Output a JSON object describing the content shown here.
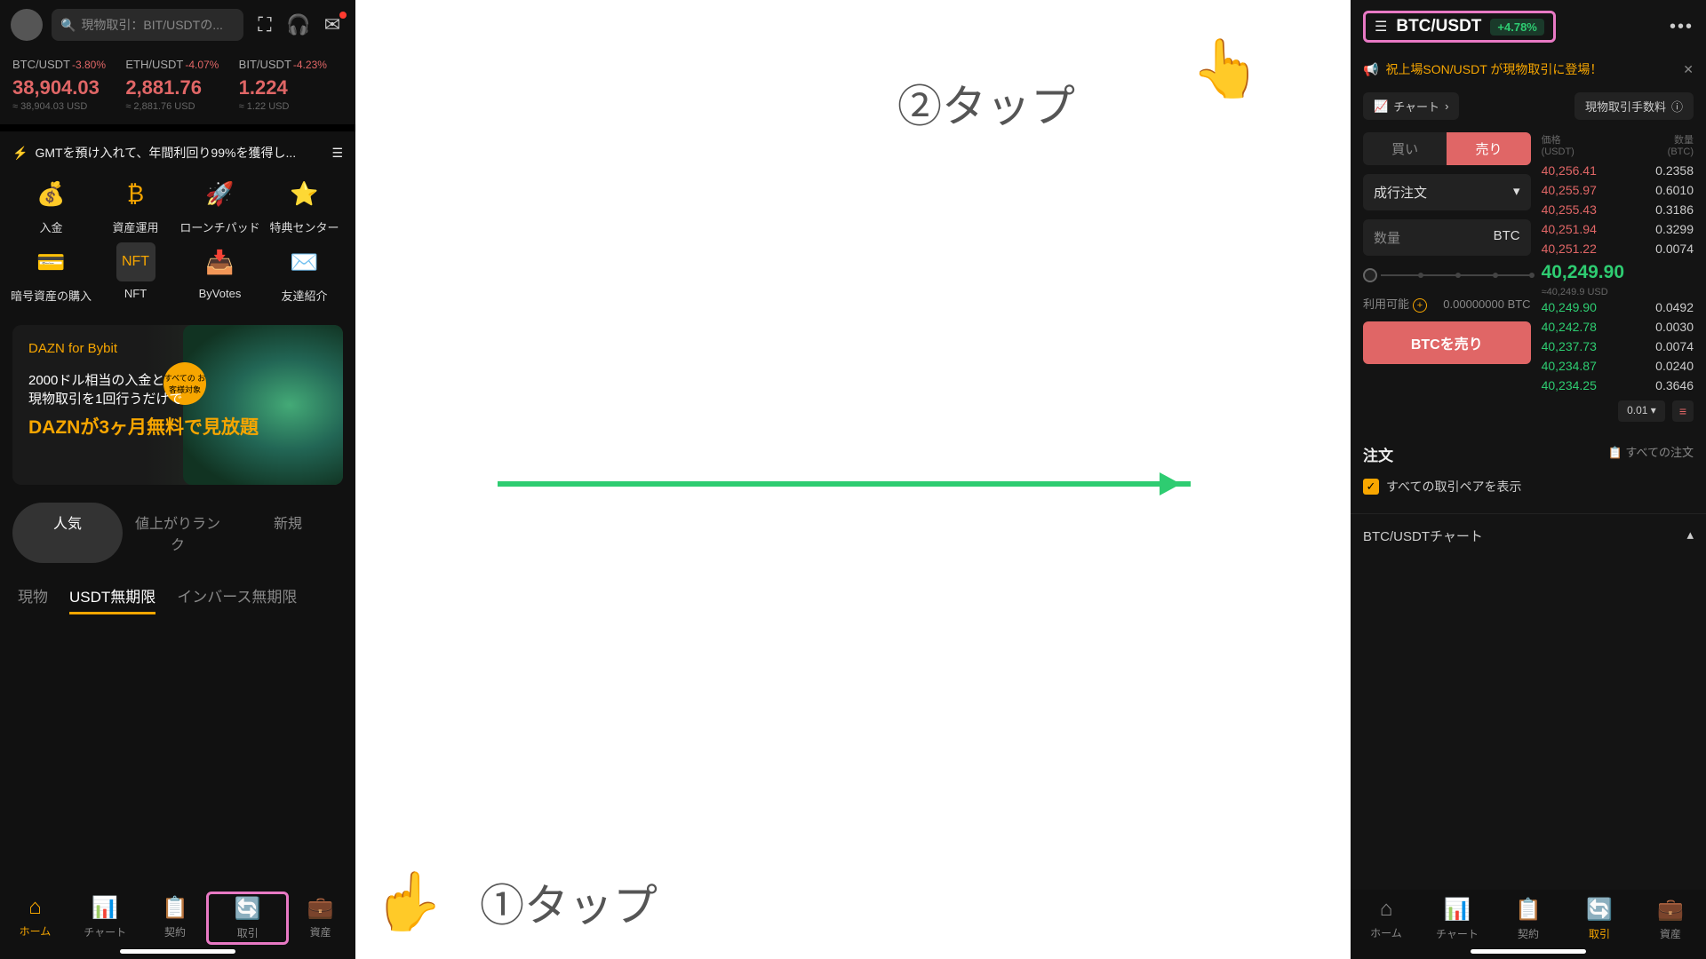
{
  "annotations": {
    "tap1": "①タップ",
    "tap2": "②タップ"
  },
  "left": {
    "search_placeholder": "現物取引：BIT/USDTの...",
    "tickers": [
      {
        "pair": "BTC/USDT",
        "chg": "-3.80%",
        "price": "38,904.03",
        "usd": "≈ 38,904.03 USD"
      },
      {
        "pair": "ETH/USDT",
        "chg": "-4.07%",
        "price": "2,881.76",
        "usd": "≈ 2,881.76 USD"
      },
      {
        "pair": "BIT/USDT",
        "chg": "-4.23%",
        "price": "1.224",
        "usd": "≈ 1.22 USD"
      }
    ],
    "banner": "GMTを預け入れて、年間利回り99%を獲得し...",
    "grid": [
      "入金",
      "資産運用",
      "ローンチパッド",
      "特典センター",
      "暗号資産の購入",
      "NFT",
      "ByVotes",
      "友達紹介"
    ],
    "promo": {
      "t1": "DAZN for Bybit",
      "t2": "2000ドル相当の入金と",
      "t3": "現物取引を1回行うだけで",
      "t4": "DAZNが3ヶ月無料で見放題",
      "badge": "すべての\nお客様対象"
    },
    "pills": [
      "人気",
      "値上がりランク",
      "新規"
    ],
    "tabs": [
      "現物",
      "USDT無期限",
      "インバース無期限"
    ],
    "nav": [
      "ホーム",
      "チャート",
      "契約",
      "取引",
      "資産"
    ]
  },
  "right": {
    "pair": "BTC/USDT",
    "change": "+4.78%",
    "announce": "祝上場SON/USDT が現物取引に登場！",
    "chart_label": "チャート",
    "fee_label": "現物取引手数料",
    "buy": "買い",
    "sell": "売り",
    "order_type": "成行注文",
    "qty_label": "数量",
    "qty_unit": "BTC",
    "avail_label": "利用可能",
    "avail_val": "0.00000000 BTC",
    "sell_btn": "BTCを売り",
    "ob_price": "価格",
    "ob_price_unit": "(USDT)",
    "ob_qty": "数量",
    "ob_qty_unit": "(BTC)",
    "asks": [
      {
        "p": "40,256.41",
        "q": "0.2358"
      },
      {
        "p": "40,255.97",
        "q": "0.6010"
      },
      {
        "p": "40,255.43",
        "q": "0.3186"
      },
      {
        "p": "40,251.94",
        "q": "0.3299"
      },
      {
        "p": "40,251.22",
        "q": "0.0074"
      }
    ],
    "mid": "40,249.90",
    "mid_usd": "≈40,249.9 USD",
    "bids": [
      {
        "p": "40,249.90",
        "q": "0.0492"
      },
      {
        "p": "40,242.78",
        "q": "0.0030"
      },
      {
        "p": "40,237.73",
        "q": "0.0074"
      },
      {
        "p": "40,234.87",
        "q": "0.0240"
      },
      {
        "p": "40,234.25",
        "q": "0.3646"
      }
    ],
    "depth_step": "0.01",
    "orders": "注文",
    "all_orders": "すべての注文",
    "show_all_pairs": "すべての取引ペアを表示",
    "chart_title": "BTC/USDTチャート",
    "nav": [
      "ホーム",
      "チャート",
      "契約",
      "取引",
      "資産"
    ]
  }
}
